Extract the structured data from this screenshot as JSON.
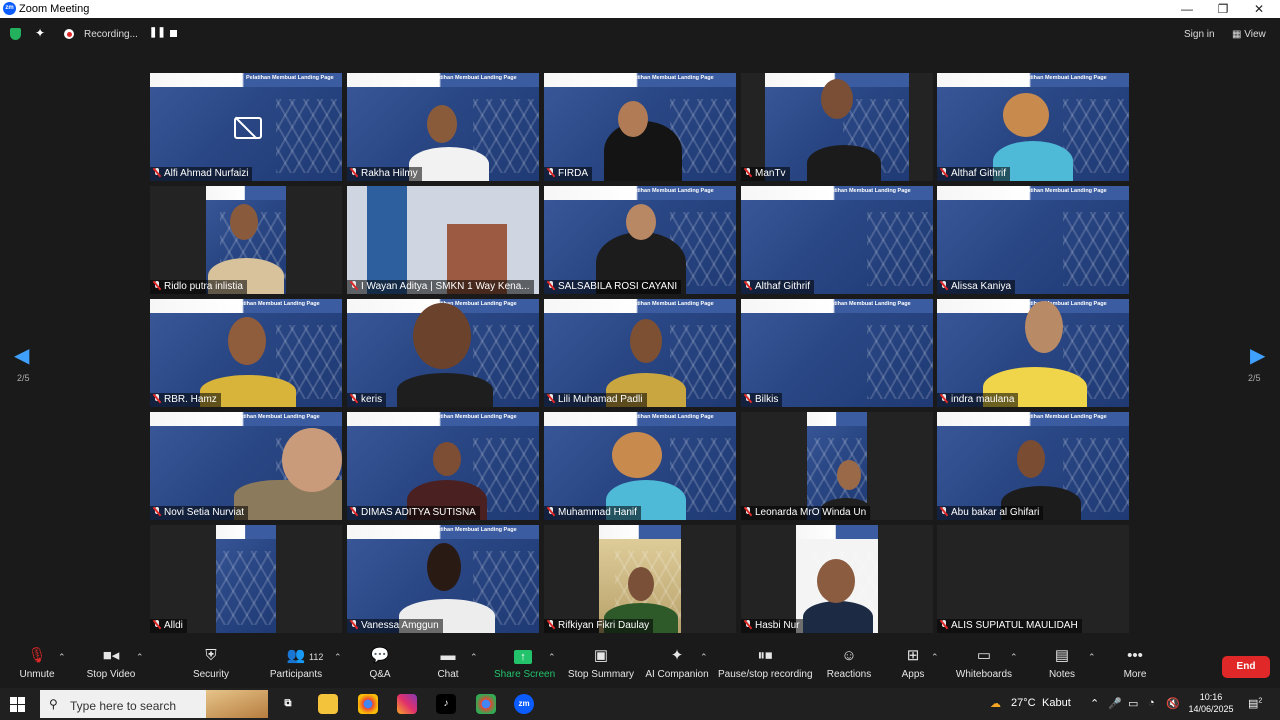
{
  "window": {
    "title": "Zoom Meeting",
    "logo": "zm",
    "controls": [
      "—",
      "❐",
      "✕"
    ]
  },
  "topbar": {
    "recording_label": "Recording...",
    "sign_in": "Sign in",
    "view": "View"
  },
  "navigation": {
    "page_left": "2/5",
    "page_right": "2/5"
  },
  "banner_text": "Pelatihan Membuat Landing Page",
  "participants": [
    {
      "name": "Alfi Ahmad Nurfaizi"
    },
    {
      "name": "Rakha Hilmy"
    },
    {
      "name": "FIRDA"
    },
    {
      "name": "ManTv"
    },
    {
      "name": "Althaf Githrif"
    },
    {
      "name": "Ridlo putra inlistia"
    },
    {
      "name": "I Wayan Aditya | SMKN 1 Way Kena..."
    },
    {
      "name": "SALSABILA ROSI CAYANI"
    },
    {
      "name": "Althaf Githrif"
    },
    {
      "name": "Alissa Kaniya"
    },
    {
      "name": "RBR. Hamz"
    },
    {
      "name": "keris"
    },
    {
      "name": "Lili Muhamad Padli"
    },
    {
      "name": "Bilkis"
    },
    {
      "name": "indra maulana"
    },
    {
      "name": "Novi Setia Nurviat"
    },
    {
      "name": "DIMAS ADITYA SUTISNA"
    },
    {
      "name": "Muhammad Hanif"
    },
    {
      "name": "Leonarda MrO Winda Un"
    },
    {
      "name": "Abu bakar al Ghifari"
    },
    {
      "name": "Alldi"
    },
    {
      "name": "Vanessa Amggun"
    },
    {
      "name": "Rifkiyan Fikri Daulay"
    },
    {
      "name": "Hasbi Nur"
    },
    {
      "name": "ALIS SUPIATUL MAULIDAH"
    }
  ],
  "toolbar": {
    "unmute": "Unmute",
    "stop_video": "Stop Video",
    "security": "Security",
    "participants": "Participants",
    "participants_count": "112",
    "qa": "Q&A",
    "chat": "Chat",
    "share_screen": "Share Screen",
    "stop_summary": "Stop Summary",
    "ai_companion": "AI Companion",
    "pause_recording": "Pause/stop recording",
    "reactions": "Reactions",
    "apps": "Apps",
    "whiteboards": "Whiteboards",
    "notes": "Notes",
    "more": "More",
    "end": "End",
    "share_color": "#23c36b",
    "end_color": "#e02828"
  },
  "taskbar": {
    "search_placeholder": "Type here to search",
    "weather_temp": "27°C",
    "weather_text": "Kabut",
    "time": "10:16",
    "date": "14/06/2025",
    "notification_count": "2"
  }
}
